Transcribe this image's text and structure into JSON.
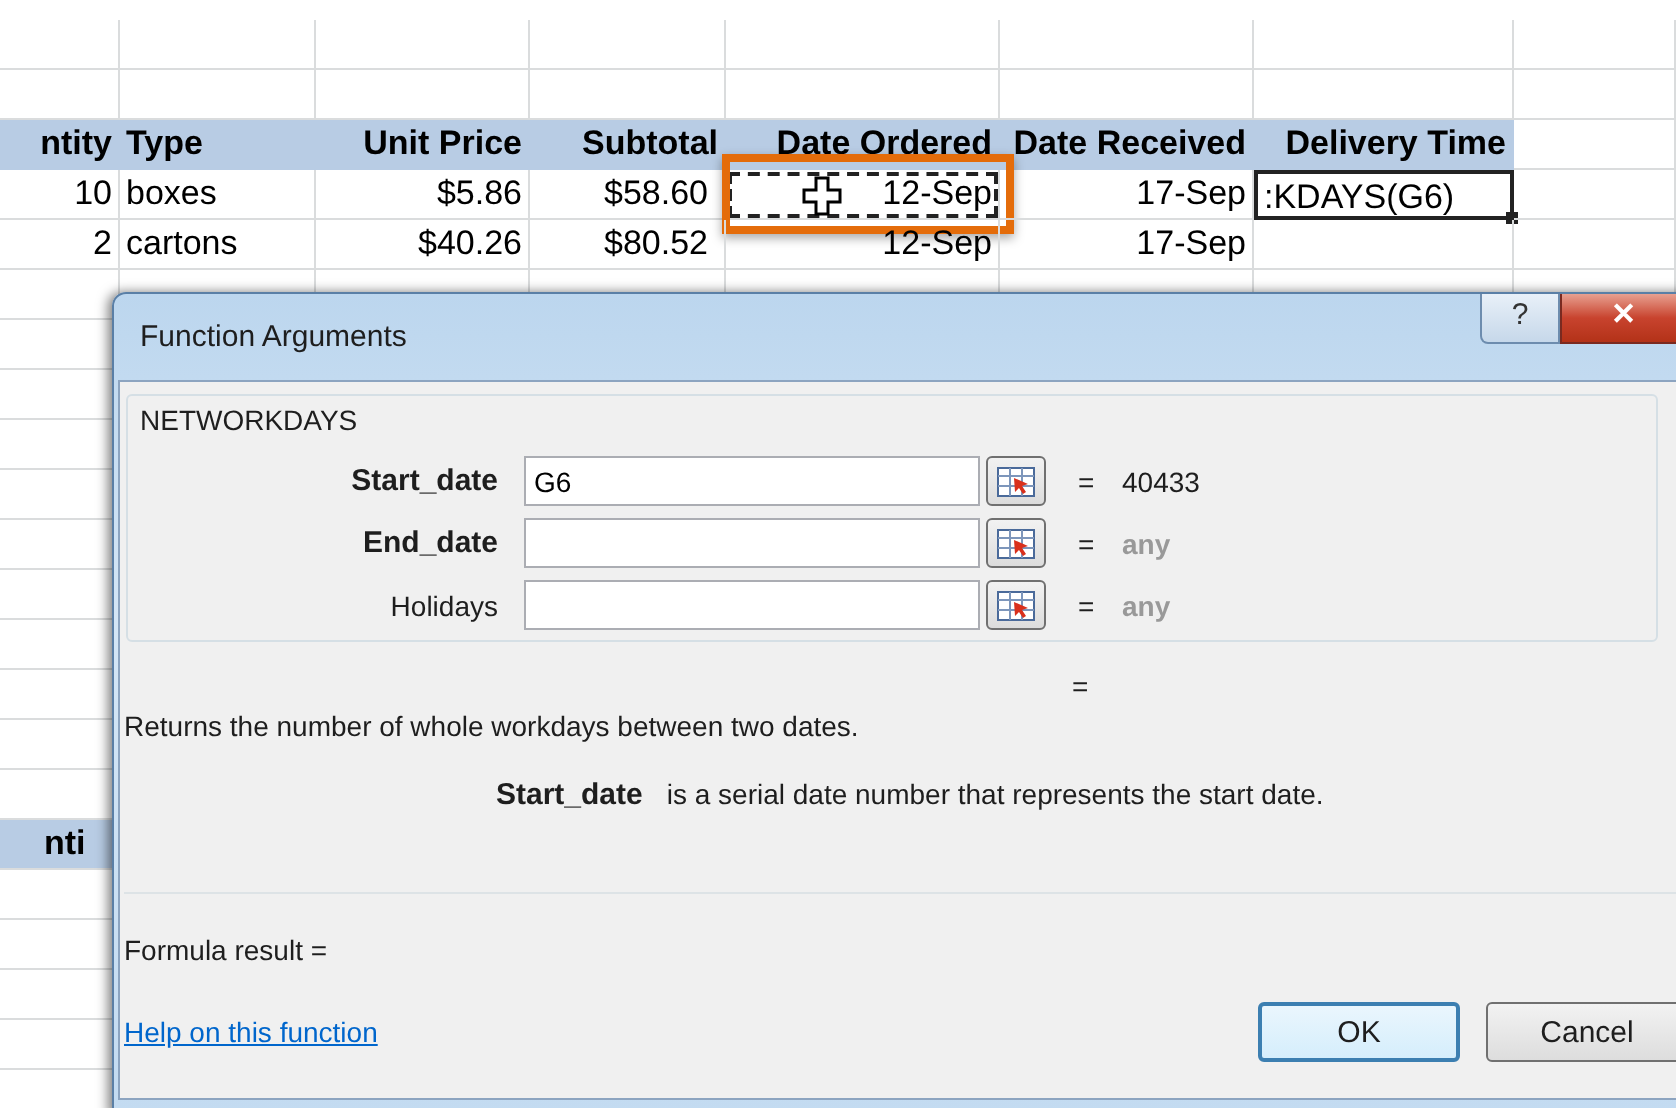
{
  "sheet": {
    "columns": [
      "ntity",
      "Type",
      "Unit Price",
      "Subtotal",
      "Date Ordered",
      "Date Received",
      "Delivery Time"
    ],
    "rows": [
      {
        "cells": [
          {
            "text": "10",
            "copied": false,
            "active": false
          },
          {
            "text": "boxes",
            "copied": false,
            "active": false
          },
          {
            "text": "$5.86",
            "copied": false,
            "active": false
          },
          {
            "text": "$58.60",
            "copied": false,
            "active": false
          },
          {
            "text": "12-Sep",
            "copied": true,
            "active": false
          },
          {
            "text": "17-Sep",
            "copied": false,
            "active": false
          },
          {
            "text": ":KDAYS(G6)",
            "copied": false,
            "active": true
          }
        ]
      },
      {
        "cells": [
          {
            "text": "2",
            "copied": false,
            "active": false
          },
          {
            "text": "cartons",
            "copied": false,
            "active": false
          },
          {
            "text": "$40.26",
            "copied": false,
            "active": false
          },
          {
            "text": "$80.52",
            "copied": false,
            "active": false
          },
          {
            "text": "12-Sep",
            "copied": false,
            "active": false
          },
          {
            "text": "17-Sep",
            "copied": false,
            "active": false
          }
        ]
      }
    ],
    "lower_header": "nti"
  },
  "dialog": {
    "title": "Function Arguments",
    "help_button": "?",
    "close_button": "✕",
    "function_name": "NETWORKDAYS",
    "arguments": [
      {
        "name": "Start_date",
        "required": true,
        "value": "G6",
        "equals": "=",
        "result": "40433",
        "evaluated": true
      },
      {
        "name": "End_date",
        "required": true,
        "equals": "=",
        "result": "any",
        "evaluated": false
      },
      {
        "name": "Holidays",
        "required": false,
        "equals": "=",
        "result": "any",
        "evaluated": false
      }
    ],
    "formula_value": "=",
    "description": "Returns the number of whole workdays between two dates.",
    "argument_help": {
      "name": "Start_date",
      "text": "is a serial date number that represents the start date."
    },
    "formula_result": "Formula result =",
    "help_link": "Help on this function",
    "buttons": [
      {
        "label": "OK",
        "default": true
      },
      {
        "label": "Cancel",
        "default": false
      }
    ]
  }
}
